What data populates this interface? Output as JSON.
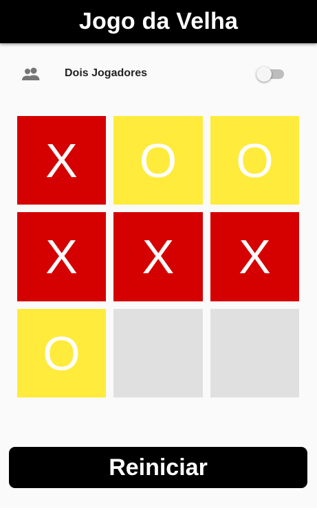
{
  "app_bar": {
    "title": "Jogo da Velha"
  },
  "mode": {
    "label": "Dois Jogadores",
    "icon": "people-icon",
    "two_players_enabled": false
  },
  "board": {
    "cells": [
      "X",
      "O",
      "O",
      "X",
      "X",
      "X",
      "O",
      "",
      ""
    ]
  },
  "restart_button": {
    "label": "Reiniciar"
  },
  "colors": {
    "x_cell": "#d50000",
    "o_cell": "#ffeb3b",
    "empty_cell": "#e0e0e0",
    "app_bar": "#000000",
    "background": "#fafafa"
  }
}
